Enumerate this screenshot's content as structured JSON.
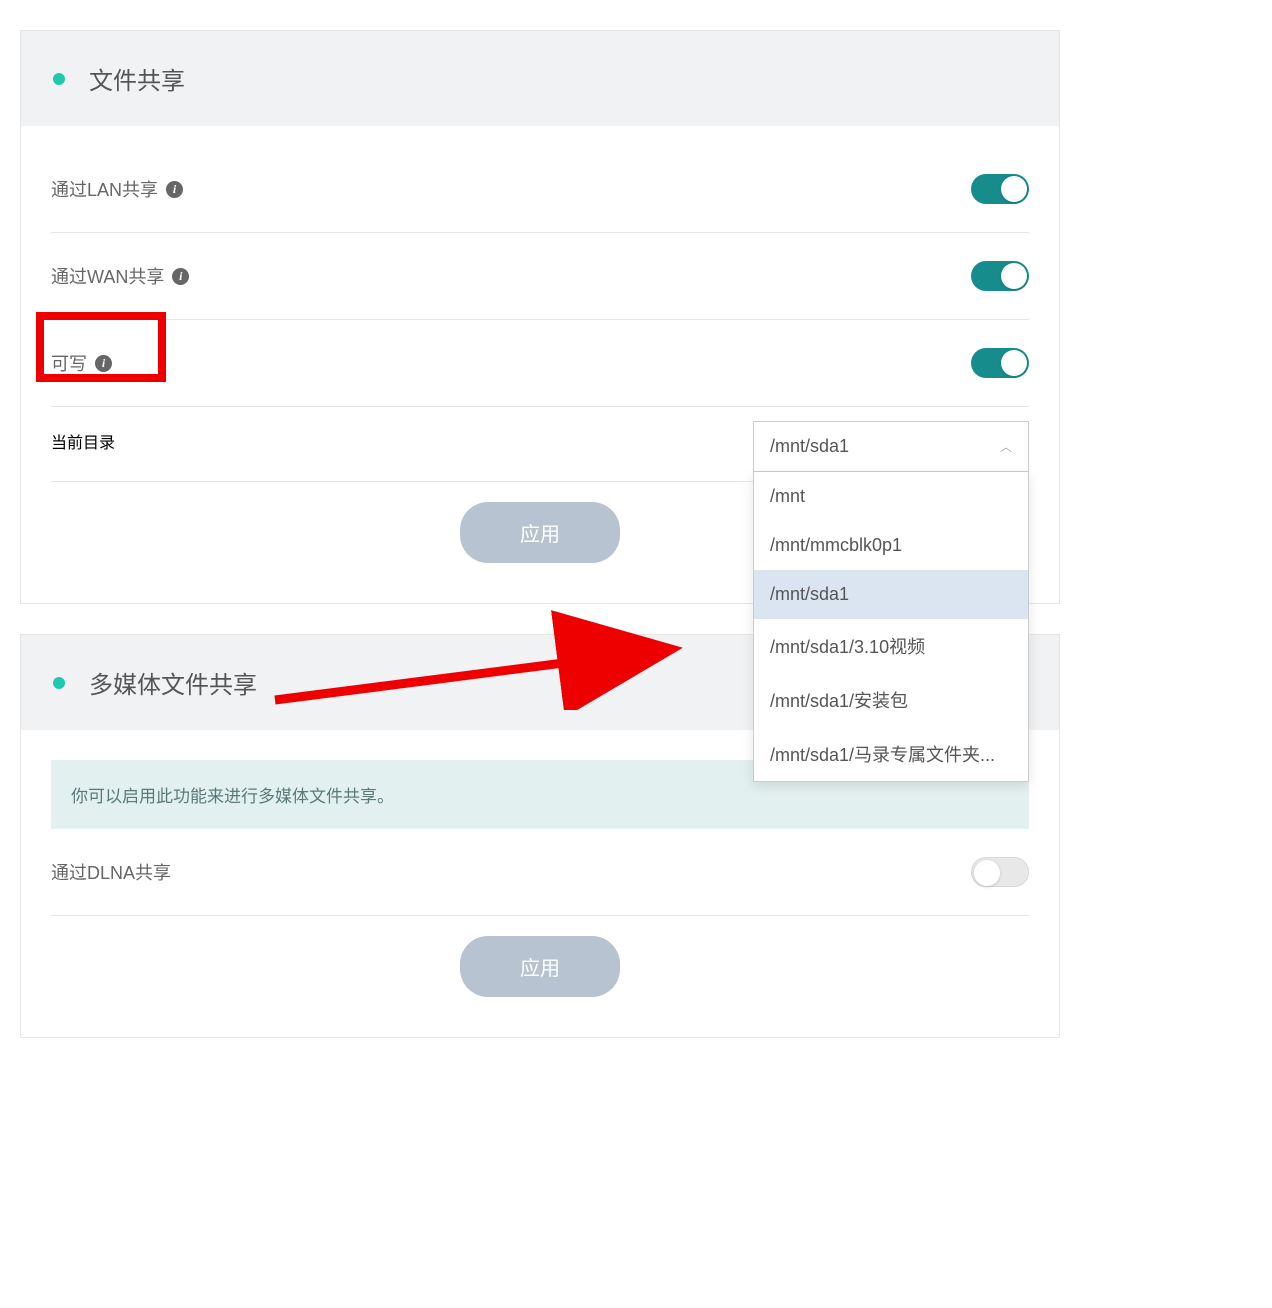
{
  "fileShare": {
    "title": "文件共享",
    "lanShare": {
      "label": "通过LAN共享",
      "on": true
    },
    "wanShare": {
      "label": "通过WAN共享",
      "on": true
    },
    "writable": {
      "label": "可写",
      "on": true
    },
    "currentDir": {
      "label": "当前目录",
      "selected": "/mnt/sda1"
    },
    "dropdown": {
      "opt0": "/mnt",
      "opt1": "/mnt/mmcblk0p1",
      "opt2": "/mnt/sda1",
      "opt3": "/mnt/sda1/3.10视频",
      "opt4": "/mnt/sda1/安装包",
      "opt5": "/mnt/sda1/马录专属文件夹..."
    },
    "applyLabel": "应用"
  },
  "mediaShare": {
    "title": "多媒体文件共享",
    "hint": "你可以启用此功能来进行多媒体文件共享。",
    "dlna": {
      "label": "通过DLNA共享",
      "on": false
    },
    "applyLabel": "应用"
  }
}
